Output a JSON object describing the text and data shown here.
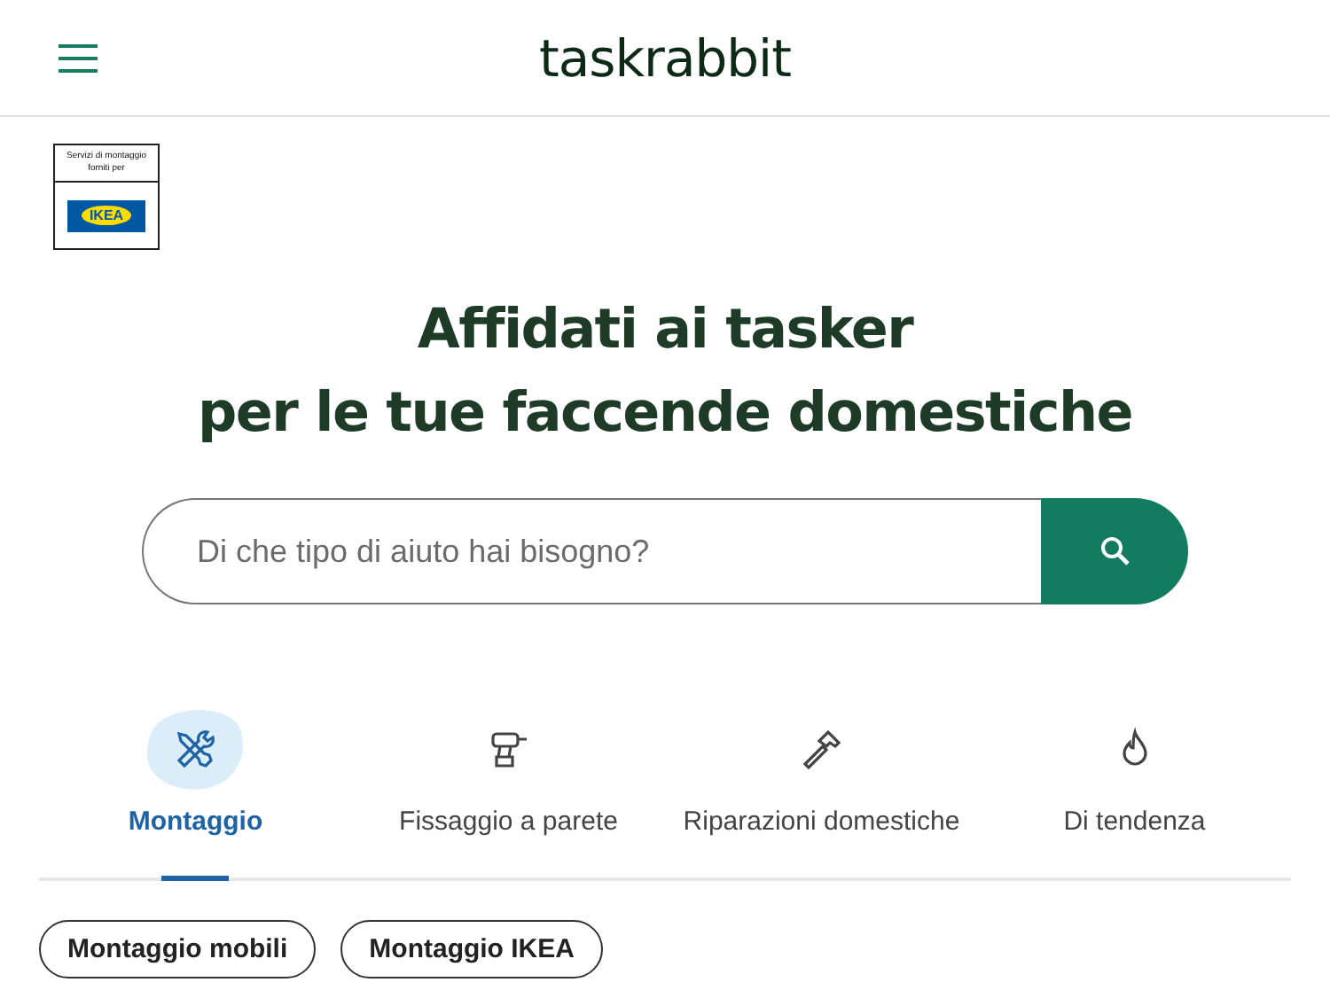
{
  "header": {
    "logo": "taskrabbit"
  },
  "partner_badge": {
    "caption": "Servizi di montaggio forniti per",
    "logo": "IKEA"
  },
  "hero": {
    "title_lines": [
      "Affidati ai tasker",
      "per le tue faccende domestiche"
    ]
  },
  "search": {
    "placeholder": "Di che tipo di aiuto hai bisogno?"
  },
  "tabs": [
    {
      "label": "Montaggio",
      "kind": "tools",
      "selected": true
    },
    {
      "label": "Fissaggio a parete",
      "kind": "drill",
      "selected": false
    },
    {
      "label": "Riparazioni domestiche",
      "kind": "hammer",
      "selected": false
    },
    {
      "label": "Di tendenza",
      "kind": "flame",
      "selected": false
    }
  ],
  "chips": [
    "Montaggio mobili",
    "Montaggio IKEA"
  ]
}
